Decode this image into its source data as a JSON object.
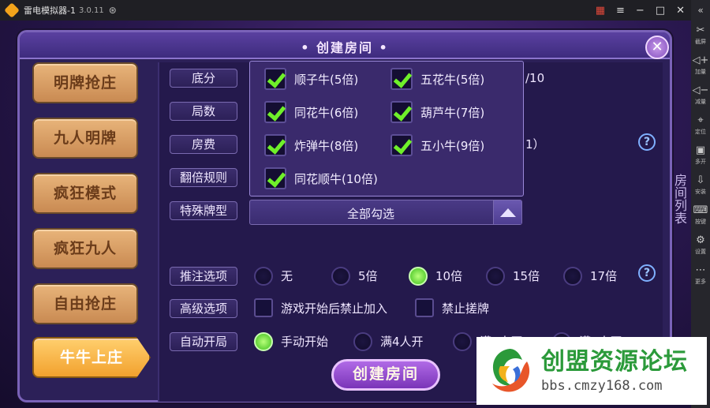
{
  "emulator": {
    "title": "雷电模拟器-1",
    "version": "3.0.11",
    "toolbar": [
      {
        "label": "截屏",
        "icon": "scissors-icon"
      },
      {
        "label": "加量",
        "icon": "volume-up-icon"
      },
      {
        "label": "减量",
        "icon": "volume-down-icon"
      },
      {
        "label": "定位",
        "icon": "location-icon"
      },
      {
        "label": "多开",
        "icon": "multi-instance-icon"
      },
      {
        "label": "安装",
        "icon": "install-icon"
      },
      {
        "label": "按键",
        "icon": "keyboard-icon"
      },
      {
        "label": "设置",
        "icon": "settings-icon"
      },
      {
        "label": "更多",
        "icon": "more-icon"
      }
    ]
  },
  "dialog": {
    "title": "• 创建房间 •",
    "close_label": "✕",
    "tabs": [
      {
        "label": "明牌抢庄",
        "active": false
      },
      {
        "label": "九人明牌",
        "active": false
      },
      {
        "label": "疯狂模式",
        "active": false
      },
      {
        "label": "疯狂九人",
        "active": false
      },
      {
        "label": "自由抢庄",
        "active": false
      },
      {
        "label": "牛牛上庄",
        "active": true
      }
    ],
    "labels": {
      "base": "底分",
      "rounds": "局数",
      "fee": "房费",
      "double_rule": "翻倍规则",
      "special": "特殊牌型",
      "push": "推注选项",
      "advanced": "高级选项",
      "auto_start": "自动开局"
    },
    "behind_text": {
      "base_tail": "/10",
      "fee_tail": "1）"
    },
    "special_select": {
      "value": "全部勾选",
      "options": [
        {
          "label": "顺子牛(5倍)",
          "checked": true
        },
        {
          "label": "五花牛(5倍)",
          "checked": true
        },
        {
          "label": "同花牛(6倍)",
          "checked": true
        },
        {
          "label": "葫芦牛(7倍)",
          "checked": true
        },
        {
          "label": "炸弹牛(8倍)",
          "checked": true
        },
        {
          "label": "五小牛(9倍)",
          "checked": true
        },
        {
          "label": "同花顺牛(10倍)",
          "checked": true
        }
      ]
    },
    "push_options": [
      {
        "label": "无",
        "selected": false
      },
      {
        "label": "5倍",
        "selected": false
      },
      {
        "label": "10倍",
        "selected": true
      },
      {
        "label": "15倍",
        "selected": false
      },
      {
        "label": "17倍",
        "selected": false
      }
    ],
    "advanced_options": [
      {
        "label": "游戏开始后禁止加入",
        "checked": false
      },
      {
        "label": "禁止搓牌",
        "checked": false
      }
    ],
    "auto_start_options": [
      {
        "label": "手动开始",
        "selected": true
      },
      {
        "label": "满4人开",
        "selected": false
      },
      {
        "label": "满5人开",
        "selected": false
      },
      {
        "label": "满6人开",
        "selected": false
      }
    ],
    "create_button": "创建房间",
    "side_hint": "房间列表"
  },
  "watermark": {
    "name": "创盟资源论坛",
    "url": "bbs.cmzy168.com"
  }
}
